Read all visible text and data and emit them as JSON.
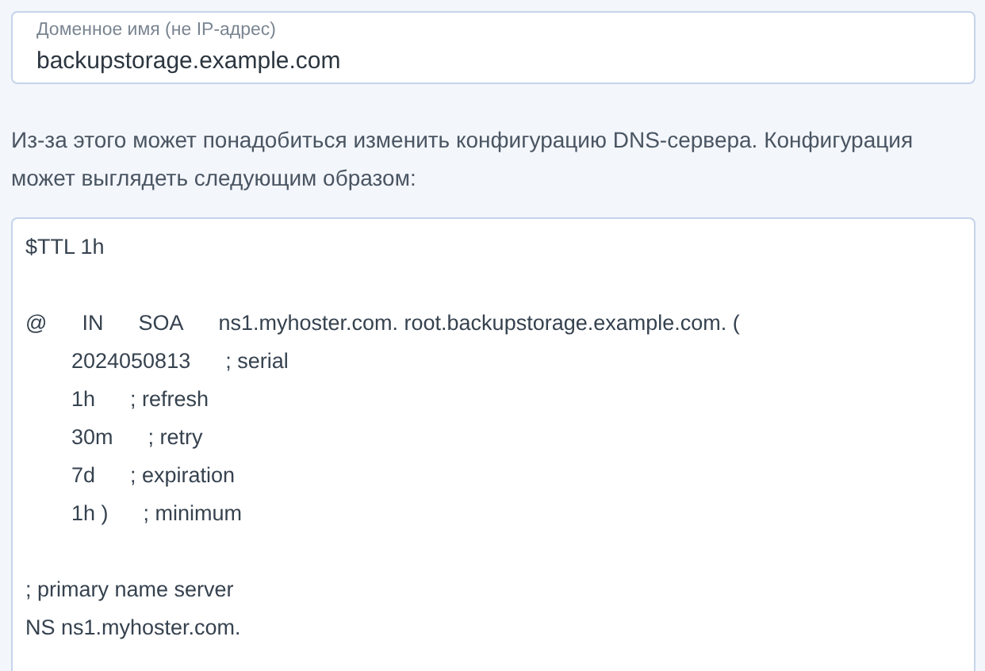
{
  "domain_field": {
    "label": "Доменное имя (не IP-адрес)",
    "value": "backupstorage.example.com"
  },
  "description": "Из-за этого может понадобиться изменить конфигурацию DNS-сервера. Конфигурация может выглядеть следующим образом:",
  "config_blocks": [
    {
      "lines": [
        {
          "indented": false,
          "tokens": [
            "$TTL 1h"
          ]
        }
      ]
    },
    {
      "lines": [
        {
          "indented": false,
          "tokens": [
            "@",
            "IN",
            "SOA",
            "ns1.myhoster.com. root.backupstorage.example.com. ("
          ]
        },
        {
          "indented": true,
          "tokens": [
            "2024050813",
            "; serial"
          ]
        },
        {
          "indented": true,
          "tokens": [
            "1h",
            "; refresh"
          ]
        },
        {
          "indented": true,
          "tokens": [
            "30m",
            "; retry"
          ]
        },
        {
          "indented": true,
          "tokens": [
            "7d",
            "; expiration"
          ]
        },
        {
          "indented": true,
          "tokens": [
            "1h )",
            "; minimum"
          ]
        }
      ]
    },
    {
      "lines": [
        {
          "indented": false,
          "tokens": [
            "; primary name server"
          ]
        },
        {
          "indented": false,
          "tokens": [
            "NS ns1.myhoster.com."
          ]
        }
      ]
    }
  ]
}
